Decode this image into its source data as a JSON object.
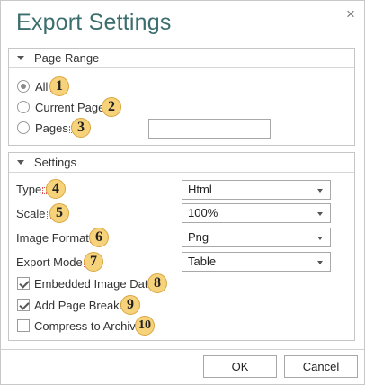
{
  "dialog": {
    "title": "Export Settings",
    "close_glyph": "×",
    "close_icon": "close-icon"
  },
  "page_range": {
    "header": "Page Range",
    "selected": "all",
    "options": [
      {
        "id": "all",
        "label": "All",
        "badge": "1"
      },
      {
        "id": "current",
        "label": "Current Page",
        "badge": "2"
      },
      {
        "id": "pages",
        "label": "Pages",
        "badge": "3"
      }
    ],
    "pages_value": ""
  },
  "settings": {
    "header": "Settings",
    "type": {
      "label": "Type",
      "badge": "4",
      "value": "Html"
    },
    "scale": {
      "label": "Scale",
      "badge": "5",
      "value": "100%"
    },
    "image_format": {
      "label": "Image Format",
      "badge": "6",
      "value": "Png"
    },
    "export_mode": {
      "label": "Export Mode",
      "badge": "7",
      "value": "Table"
    },
    "embedded_image_data": {
      "label": "Embedded Image Data",
      "badge": "8",
      "checked": true
    },
    "add_page_breaks": {
      "label": "Add Page Breaks",
      "badge": "9",
      "checked": true
    },
    "compress_to_archive": {
      "label": "Compress to Archive",
      "badge": "10",
      "checked": false
    }
  },
  "buttons": {
    "ok": "OK",
    "cancel": "Cancel"
  },
  "colors": {
    "title": "#3c6e6e",
    "badge_fill": "#f6d27a",
    "badge_border": "#d9a640",
    "marker": "#e05050"
  }
}
